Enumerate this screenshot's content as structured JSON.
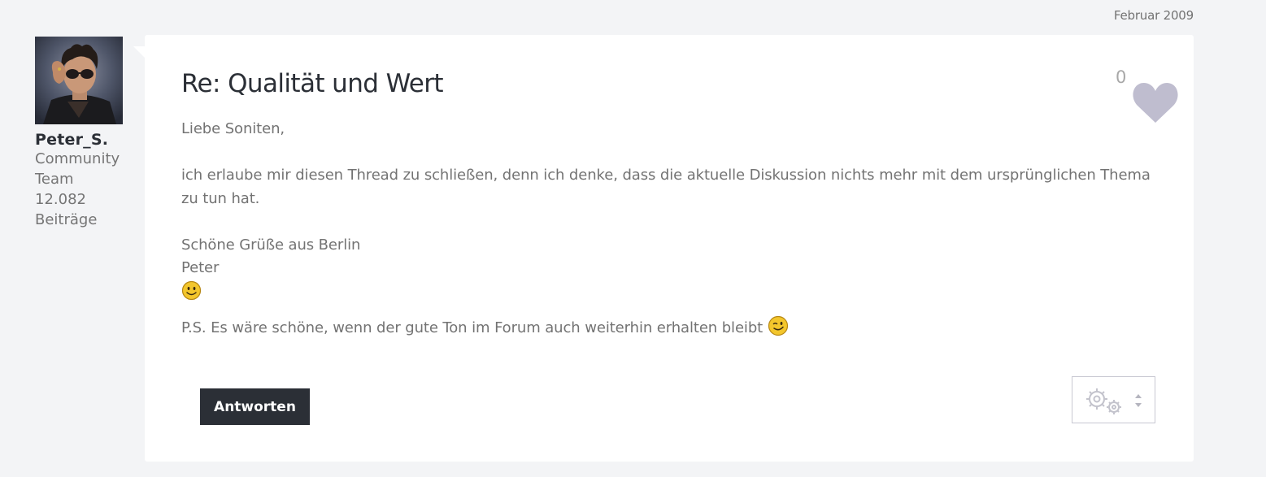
{
  "post": {
    "date": "Februar 2009",
    "title": "Re: Qualität und Wert",
    "body": {
      "greeting": "Liebe Soniten,",
      "paragraph": "ich erlaube mir diesen Thread zu schließen, denn ich denke, dass die aktuelle Diskussion nichts mehr mit dem ursprünglichen Thema zu tun hat.",
      "closing": "Schöne Grüße aus Berlin",
      "signature": "Peter",
      "ps": "P.S. Es wäre schöne, wenn der gute Ton im Forum auch weiterhin erhalten bleibt"
    },
    "kudos_count": "0"
  },
  "author": {
    "name": "Peter_S.",
    "role_line1": "Community",
    "role_line2": "Team",
    "post_count": "12.082",
    "post_count_label": "Beiträge"
  },
  "actions": {
    "reply_label": "Antworten"
  },
  "icons": {
    "kudos": "heart-icon",
    "options": "gears-icon",
    "options_arrow": "sort-arrows-icon",
    "emoji1": "smile-emoji",
    "emoji2": "wink-emoji"
  },
  "colors": {
    "background": "#f3f4f6",
    "card": "#ffffff",
    "heading_text": "#2b2f36",
    "body_text": "#737373",
    "button_bg": "#2b2f36",
    "heart": "#bfbdcf"
  }
}
